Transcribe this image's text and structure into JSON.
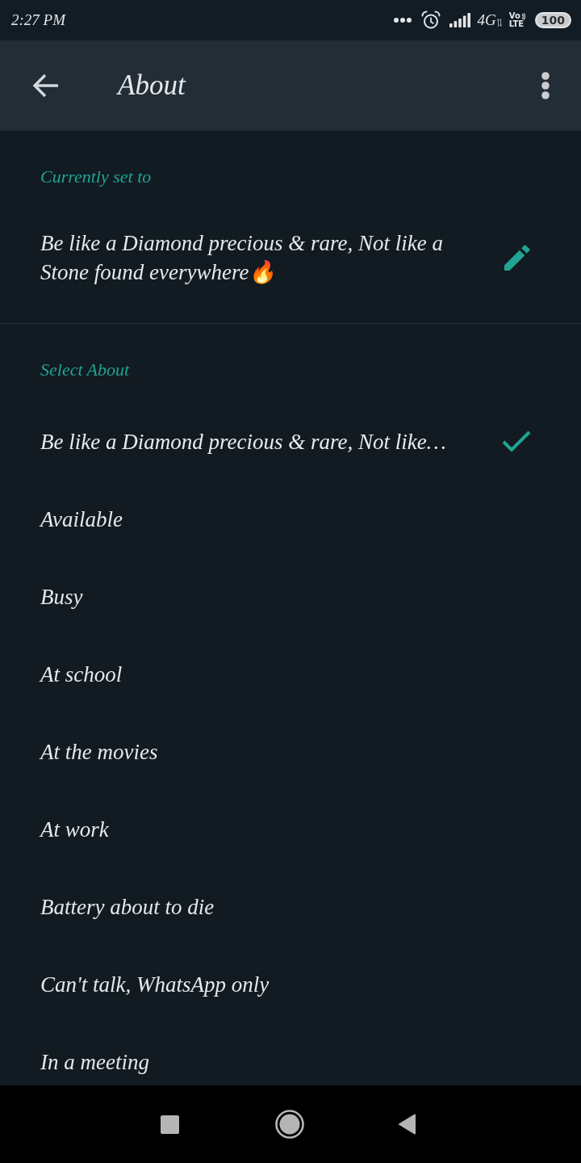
{
  "status_bar": {
    "time": "2:27 PM",
    "network": "4G",
    "volte_top": "Vo",
    "volte_bottom": "LTE",
    "battery": "100"
  },
  "app_bar": {
    "title": "About"
  },
  "current": {
    "heading": "Currently set to",
    "text": "Be like a Diamond precious & rare, Not like a Stone found everywhere🔥"
  },
  "select": {
    "heading": "Select About",
    "items": [
      {
        "label": "Be like a Diamond precious & rare, Not like…",
        "selected": true
      },
      {
        "label": "Available",
        "selected": false
      },
      {
        "label": "Busy",
        "selected": false
      },
      {
        "label": "At school",
        "selected": false
      },
      {
        "label": "At the movies",
        "selected": false
      },
      {
        "label": "At work",
        "selected": false
      },
      {
        "label": "Battery about to die",
        "selected": false
      },
      {
        "label": "Can't talk, WhatsApp only",
        "selected": false
      },
      {
        "label": "In a meeting",
        "selected": false
      }
    ]
  }
}
